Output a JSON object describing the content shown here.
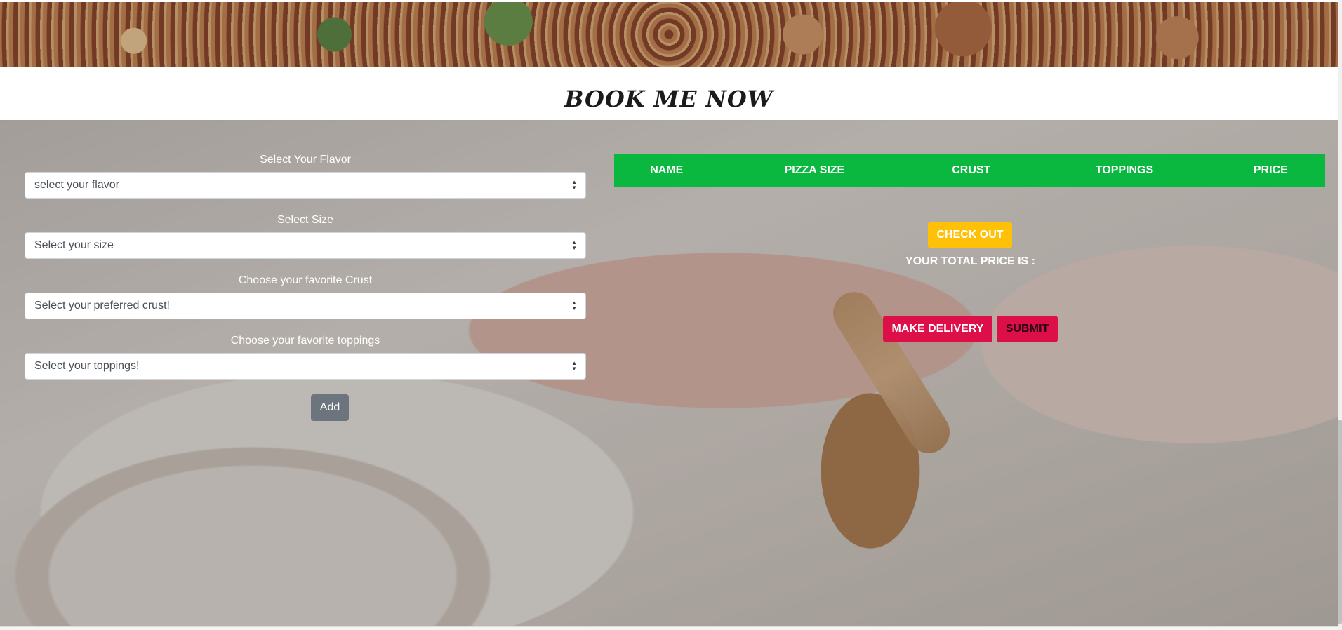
{
  "booking": {
    "title": "BOOK ME NOW"
  },
  "form": {
    "flavor": {
      "label": "Select Your Flavor",
      "selected": "select your flavor"
    },
    "size": {
      "label": "Select Size",
      "selected": "Select your size"
    },
    "crust": {
      "label": "Choose your favorite Crust",
      "selected": "Select your preferred crust!"
    },
    "toppings": {
      "label": "Choose your favorite toppings",
      "selected": "Select your toppings!"
    },
    "add_label": "Add"
  },
  "order_table": {
    "columns": [
      "NAME",
      "PIZZA SIZE",
      "CRUST",
      "TOPPINGS",
      "PRICE"
    ],
    "header_color": "#0ab83f"
  },
  "actions": {
    "checkout_label": "CHECK OUT",
    "total_price_label": "YOUR TOTAL PRICE IS :",
    "delivery_label": "MAKE DELIVERY",
    "submit_label": "SUBMIT"
  },
  "colors": {
    "checkout": "#ffc107",
    "delivery": "#dc0f49",
    "add": "#6c757d"
  }
}
